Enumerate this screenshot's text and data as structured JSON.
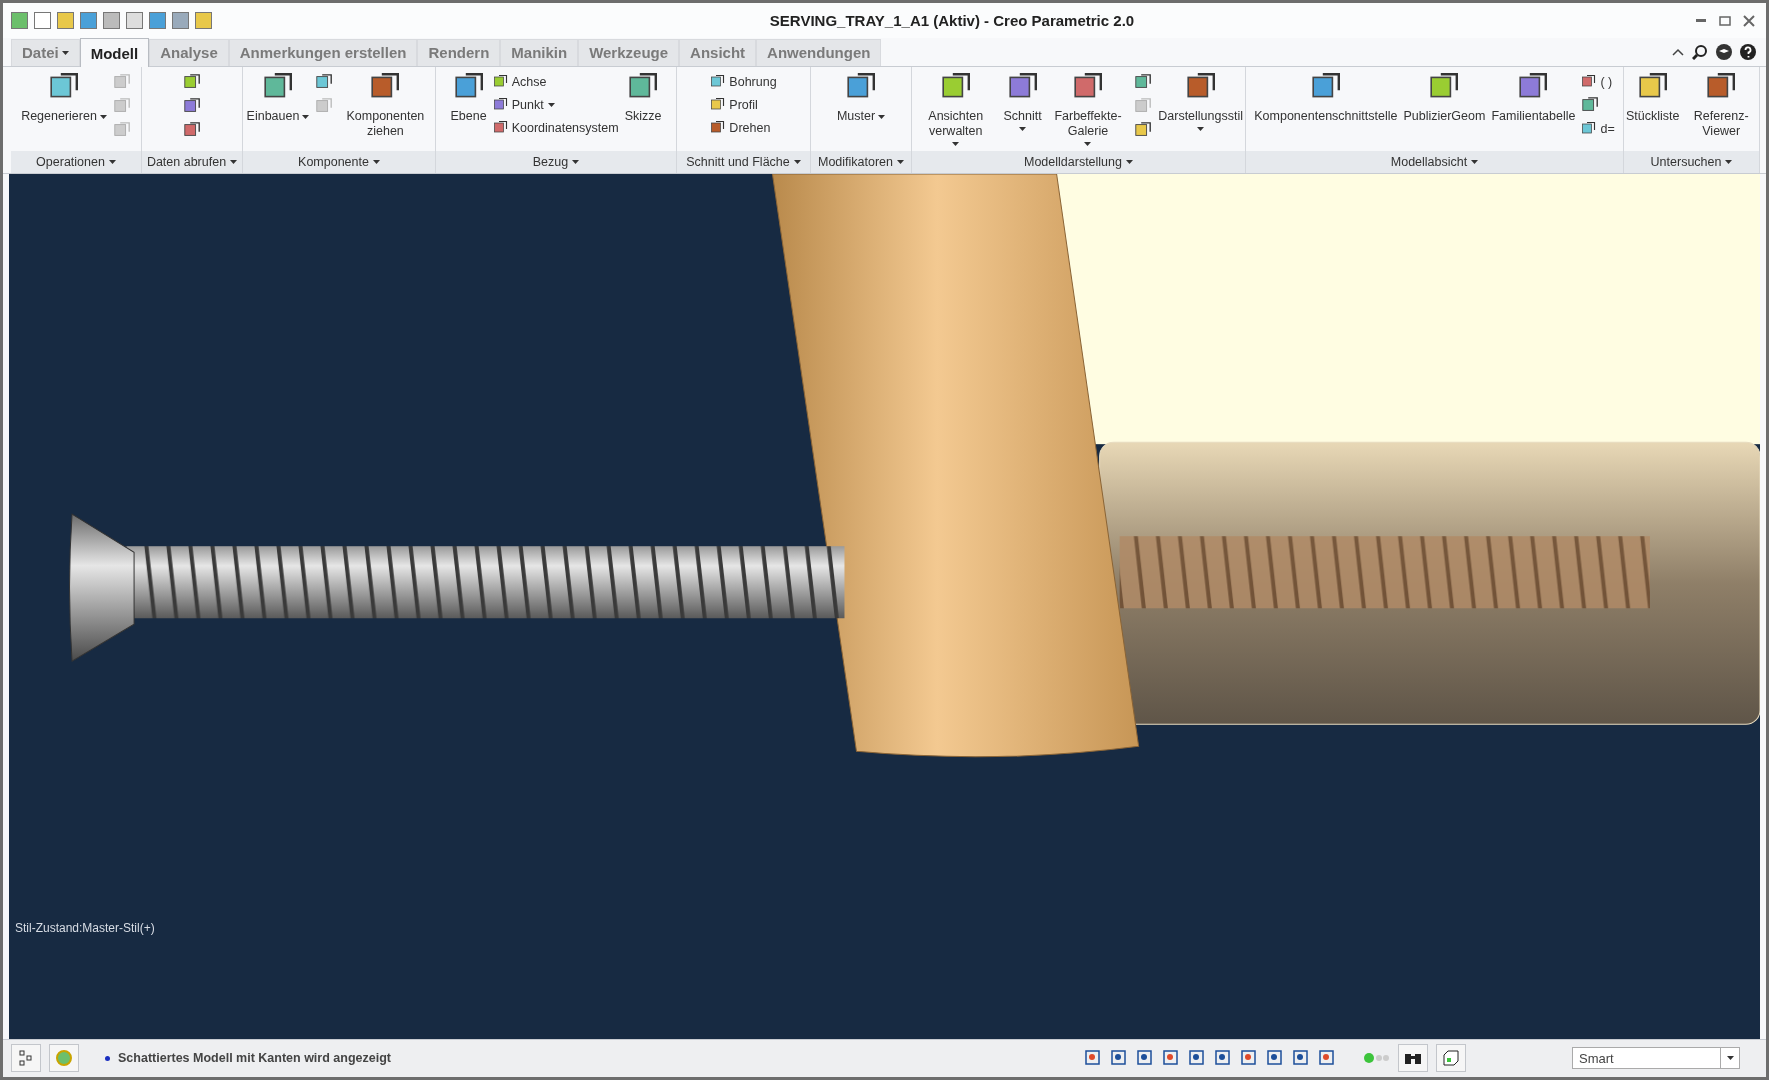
{
  "window": {
    "title": "SERVING_TRAY_1_A1 (Aktiv) - Creo Parametric 2.0"
  },
  "tabs": [
    {
      "label": "Datei",
      "selected": false,
      "menu": true
    },
    {
      "label": "Modell",
      "selected": true,
      "menu": false
    },
    {
      "label": "Analyse",
      "selected": false,
      "menu": false
    },
    {
      "label": "Anmerkungen erstellen",
      "selected": false,
      "menu": false
    },
    {
      "label": "Rendern",
      "selected": false,
      "menu": false
    },
    {
      "label": "Manikin",
      "selected": false,
      "menu": false
    },
    {
      "label": "Werkzeuge",
      "selected": false,
      "menu": false
    },
    {
      "label": "Ansicht",
      "selected": false,
      "menu": false
    },
    {
      "label": "Anwendungen",
      "selected": false,
      "menu": false
    }
  ],
  "ribbon": [
    {
      "label": "Operationen",
      "items": [
        {
          "kind": "large",
          "label": "Regenerieren",
          "menu": true
        },
        {
          "kind": "stack",
          "children": [
            {
              "kind": "icon",
              "disabled": true
            },
            {
              "kind": "icon",
              "disabled": true
            },
            {
              "kind": "icon",
              "disabled": true
            }
          ]
        }
      ]
    },
    {
      "label": "Daten abrufen",
      "items": [
        {
          "kind": "stack",
          "children": [
            {
              "kind": "icon",
              "disabled": false
            },
            {
              "kind": "icon",
              "disabled": false
            },
            {
              "kind": "icon",
              "disabled": false
            }
          ]
        }
      ]
    },
    {
      "label": "Komponente",
      "items": [
        {
          "kind": "large",
          "label": "Einbauen",
          "menu": true
        },
        {
          "kind": "stack",
          "children": [
            {
              "kind": "icon",
              "disabled": false
            },
            {
              "kind": "icon",
              "disabled": true
            }
          ]
        },
        {
          "kind": "large",
          "label": "Komponenten ziehen",
          "menu": false
        }
      ]
    },
    {
      "label": "Bezug",
      "items": [
        {
          "kind": "large",
          "label": "Ebene",
          "menu": false
        },
        {
          "kind": "stack",
          "children": [
            {
              "kind": "small",
              "label": "Achse",
              "menu": false
            },
            {
              "kind": "small",
              "label": "Punkt",
              "menu": true
            },
            {
              "kind": "small",
              "label": "Koordinatensystem",
              "menu": false
            }
          ]
        },
        {
          "kind": "large",
          "label": "Skizze",
          "menu": false
        }
      ]
    },
    {
      "label": "Schnitt und Fläche",
      "items": [
        {
          "kind": "stack",
          "children": [
            {
              "kind": "small",
              "label": "Bohrung",
              "menu": false
            },
            {
              "kind": "small",
              "label": "Profil",
              "menu": false
            },
            {
              "kind": "small",
              "label": "Drehen",
              "menu": false
            }
          ]
        }
      ]
    },
    {
      "label": "Modifikatoren",
      "items": [
        {
          "kind": "large",
          "label": "Muster",
          "menu": true
        }
      ]
    },
    {
      "label": "Modelldarstellung",
      "items": [
        {
          "kind": "large",
          "label": "Ansichten verwalten",
          "menu": true
        },
        {
          "kind": "large",
          "label": "Schnitt",
          "menu": true
        },
        {
          "kind": "large",
          "label": "Farbeffekte-Galerie",
          "menu": true
        },
        {
          "kind": "stack",
          "children": [
            {
              "kind": "icon",
              "disabled": false
            },
            {
              "kind": "icon",
              "disabled": true
            },
            {
              "kind": "icon",
              "disabled": false
            }
          ]
        },
        {
          "kind": "large",
          "label": "Darstellungsstil",
          "menu": true
        }
      ]
    },
    {
      "label": "Modellabsicht",
      "items": [
        {
          "kind": "large",
          "label": "Komponentenschnittstelle",
          "menu": false
        },
        {
          "kind": "large",
          "label": "PublizierGeom",
          "menu": false
        },
        {
          "kind": "large",
          "label": "Familientabelle",
          "menu": false
        },
        {
          "kind": "stack",
          "children": [
            {
              "kind": "small",
              "label": "( )",
              "menu": false
            },
            {
              "kind": "icon",
              "disabled": false
            },
            {
              "kind": "small",
              "label": "d=",
              "menu": false
            }
          ]
        }
      ]
    },
    {
      "label": "Untersuchen",
      "items": [
        {
          "kind": "large",
          "label": "Stückliste",
          "menu": false
        },
        {
          "kind": "large",
          "label": "Referenz-Viewer",
          "menu": false
        }
      ]
    }
  ],
  "viewport": {
    "style_state": "Stil-Zustand:Master-Stil(+)"
  },
  "status_bar": {
    "message": "Schattiertes Modell mit Kanten wird angezeigt",
    "filter": "Smart"
  }
}
